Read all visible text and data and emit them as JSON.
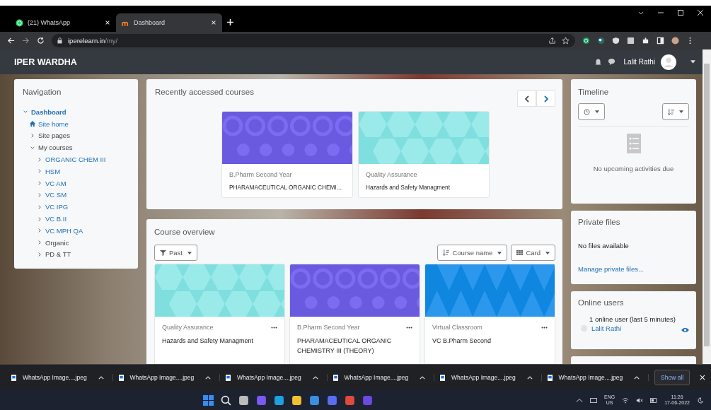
{
  "browser": {
    "tabs": [
      {
        "title": "(21) WhatsApp",
        "kind": "whatsapp",
        "selected": false
      },
      {
        "title": "Dashboard",
        "kind": "moodle",
        "selected": true
      }
    ],
    "address": {
      "domain": "iperelearn.in",
      "path": "/my/"
    }
  },
  "site": {
    "title": "IPER WARDHA",
    "user_name": "Lalit Rathi"
  },
  "navigation": {
    "title": "Navigation",
    "items": [
      {
        "label": "Dashboard",
        "kind": "current",
        "expanded": true,
        "children": [
          {
            "label": "Site home",
            "kind": "home"
          },
          {
            "label": "Site pages",
            "kind": "branch",
            "expanded": false
          },
          {
            "label": "My courses",
            "kind": "branch",
            "expanded": true,
            "children": [
              {
                "label": "ORGANIC CHEM III",
                "kind": "link",
                "expanded": false
              },
              {
                "label": "HSM",
                "kind": "link",
                "expanded": false
              },
              {
                "label": "VC AM",
                "kind": "link",
                "expanded": false
              },
              {
                "label": "VC SM",
                "kind": "link",
                "expanded": false
              },
              {
                "label": "VC IPG",
                "kind": "link",
                "expanded": false
              },
              {
                "label": "VC B.II",
                "kind": "link",
                "expanded": false
              },
              {
                "label": "VC MPH QA",
                "kind": "link",
                "expanded": false
              },
              {
                "label": "Organic",
                "kind": "branch",
                "expanded": false
              },
              {
                "label": "PD & TT",
                "kind": "branch",
                "expanded": false
              }
            ]
          }
        ]
      }
    ]
  },
  "recent": {
    "title": "Recently accessed courses",
    "courses": [
      {
        "category": "B.Pharm Second Year",
        "name": "PHARAMACEUTICAL ORGANIC CHEMI...",
        "kind": "circles"
      },
      {
        "category": "Quality Assurance",
        "name": "Hazards and Safety Managment",
        "kind": "hexagons"
      }
    ]
  },
  "overview": {
    "title": "Course overview",
    "filter": "Past",
    "sort": "Course name",
    "view": "Card",
    "courses": [
      {
        "category": "Quality Assurance",
        "name": "Hazards and Safety Managment",
        "kind": "hexagons"
      },
      {
        "category": "B.Pharm Second Year",
        "name": "PHARAMACEUTICAL ORGANIC CHEMISTRY III (THEORY)",
        "kind": "circles"
      },
      {
        "category": "Virtual Classroom",
        "name": "VC B.Pharm Second",
        "kind": "triangles"
      }
    ]
  },
  "timeline": {
    "title": "Timeline",
    "empty_message": "No upcoming activities due"
  },
  "private_files": {
    "title": "Private files",
    "message": "No files available",
    "link": "Manage private files..."
  },
  "online_users": {
    "title": "Online users",
    "summary": "1 online user (last 5 minutes)",
    "users": [
      "Lalit Rathi"
    ]
  },
  "downloads": {
    "items": [
      "WhatsApp Image....jpeg",
      "WhatsApp Image....jpeg",
      "WhatsApp Image....jpeg",
      "WhatsApp Image....jpeg",
      "WhatsApp Image....jpeg",
      "WhatsApp Image....jpeg"
    ],
    "show_all": "Show all"
  },
  "taskbar": {
    "language": "ENG",
    "region": "US",
    "time": "11:26",
    "date": "17-06-2022"
  }
}
